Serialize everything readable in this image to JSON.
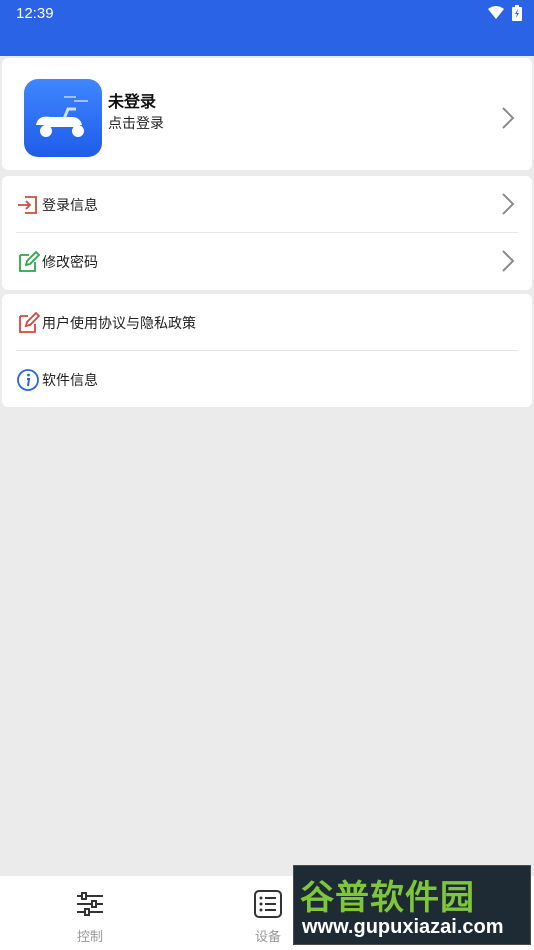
{
  "status_bar": {
    "time": "12:39",
    "color": "#2a63e6"
  },
  "profile": {
    "name": "未登录",
    "subtitle": "点击登录"
  },
  "menu_group_1": [
    {
      "label": "登录信息",
      "icon": "login-icon"
    },
    {
      "label": "修改密码",
      "icon": "edit-password-icon"
    }
  ],
  "menu_group_2": [
    {
      "label": "用户使用协议与隐私政策",
      "icon": "agreement-icon"
    },
    {
      "label": "软件信息",
      "icon": "info-icon"
    }
  ],
  "tabs": [
    {
      "label": "控制",
      "icon": "sliders-icon"
    },
    {
      "label": "设备",
      "icon": "list-icon"
    }
  ],
  "watermark": {
    "title": "谷普软件园",
    "url": "www.gupuxiazai.com"
  }
}
